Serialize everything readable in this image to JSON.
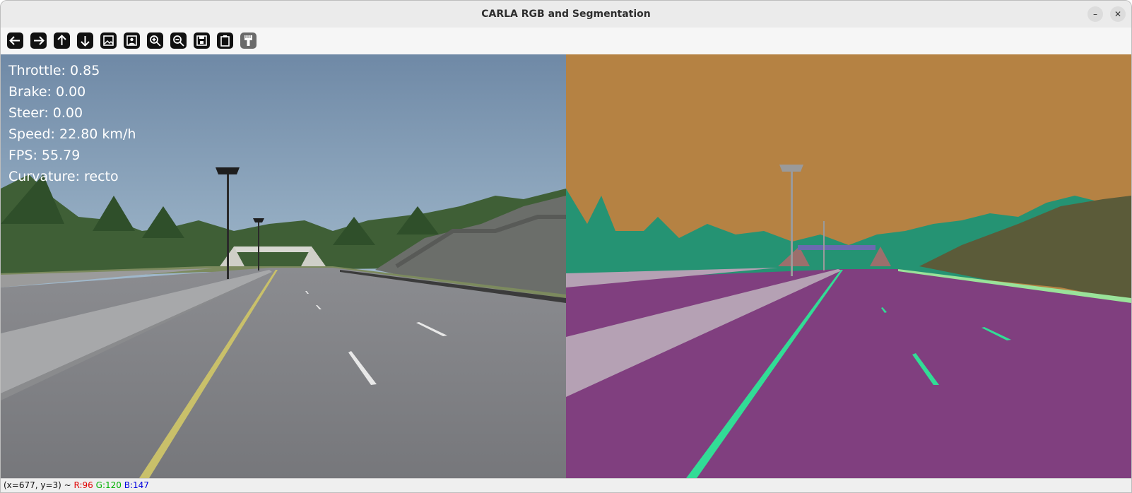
{
  "window": {
    "title": "CARLA RGB and Segmentation",
    "minimize_glyph": "–",
    "close_glyph": "✕"
  },
  "toolbar": {
    "buttons": [
      {
        "icon": "arrow-left-icon"
      },
      {
        "icon": "arrow-right-icon"
      },
      {
        "icon": "arrow-up-icon"
      },
      {
        "icon": "arrow-down-icon"
      },
      {
        "icon": "image-icon"
      },
      {
        "icon": "image-person-icon"
      },
      {
        "icon": "zoom-in-icon"
      },
      {
        "icon": "zoom-out-icon"
      },
      {
        "icon": "save-icon"
      },
      {
        "icon": "clipboard-icon"
      },
      {
        "icon": "paint-brush-icon"
      }
    ]
  },
  "hud": {
    "throttle": "Throttle: 0.85",
    "brake": "Brake: 0.00",
    "steer": "Steer: 0.00",
    "speed": "Speed: 22.80 km/h",
    "fps": "FPS: 55.79",
    "curvature": "Curvature: recto"
  },
  "status": {
    "coords": "(x=677, y=3) ~ ",
    "r": "R:96",
    "g": "G:120",
    "b": "B:147",
    "colors": {
      "r": "#e00000",
      "g": "#00b000",
      "b": "#0000e0"
    }
  },
  "segmentation_colors": {
    "sky": "#b58243",
    "vegetation": "#259373",
    "terrain": "#5b5b39",
    "road": "#803f7f",
    "sidewalk": "#b5a1b4",
    "lane_marking": "#32dc96",
    "pole": "#9a9a9a",
    "bridge": "#9c6f6c"
  }
}
